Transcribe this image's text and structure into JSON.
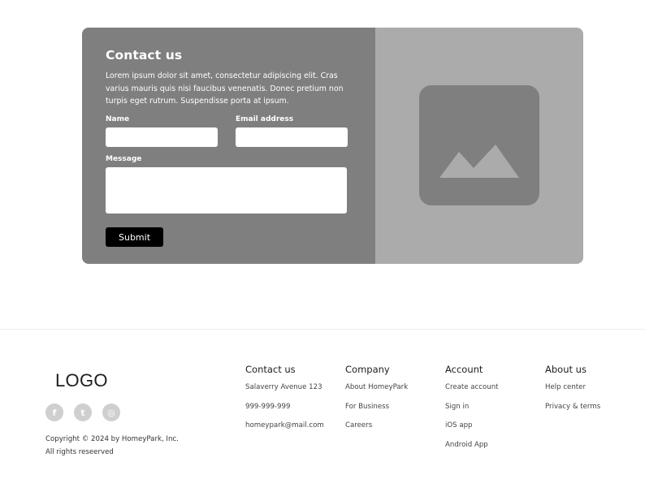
{
  "contact": {
    "title": "Contact us",
    "description": "Lorem ipsum dolor sit amet, consectetur adipiscing elit. Cras varius mauris quis nisi faucibus venenatis. Donec pretium non turpis eget rutrum. Suspendisse porta at ipsum.",
    "name_label": "Name",
    "email_label": "Email address",
    "message_label": "Message",
    "name_value": "",
    "email_value": "",
    "message_value": "",
    "submit_label": "Submit"
  },
  "image": {
    "icon": "image-placeholder-icon"
  },
  "footer": {
    "logo": "LOGO",
    "socials": [
      {
        "icon": "facebook-icon",
        "glyph": "f"
      },
      {
        "icon": "twitter-icon",
        "glyph": "t"
      },
      {
        "icon": "instagram-icon",
        "glyph": "◎"
      }
    ],
    "copyright_line1": "Copyright © 2024 by HomeyPark, Inc.",
    "copyright_line2": "All rights reseerved",
    "columns": [
      {
        "heading": "Contact us",
        "links": [
          "Salaverry Avenue 123",
          "999-999-999",
          "homeypark@mail.com"
        ]
      },
      {
        "heading": "Company",
        "links": [
          "About HomeyPark",
          "For Business",
          "Careers"
        ]
      },
      {
        "heading": "Account",
        "links": [
          "Create account",
          "Sign in",
          "iOS app",
          "Android App"
        ]
      },
      {
        "heading": "About us",
        "links": [
          "Help center",
          "Privacy & terms"
        ]
      }
    ]
  },
  "colors": {
    "card_left": "#7f7f7f",
    "card_right": "#ababab",
    "button": "#000000",
    "social": "#cfcfcf"
  }
}
